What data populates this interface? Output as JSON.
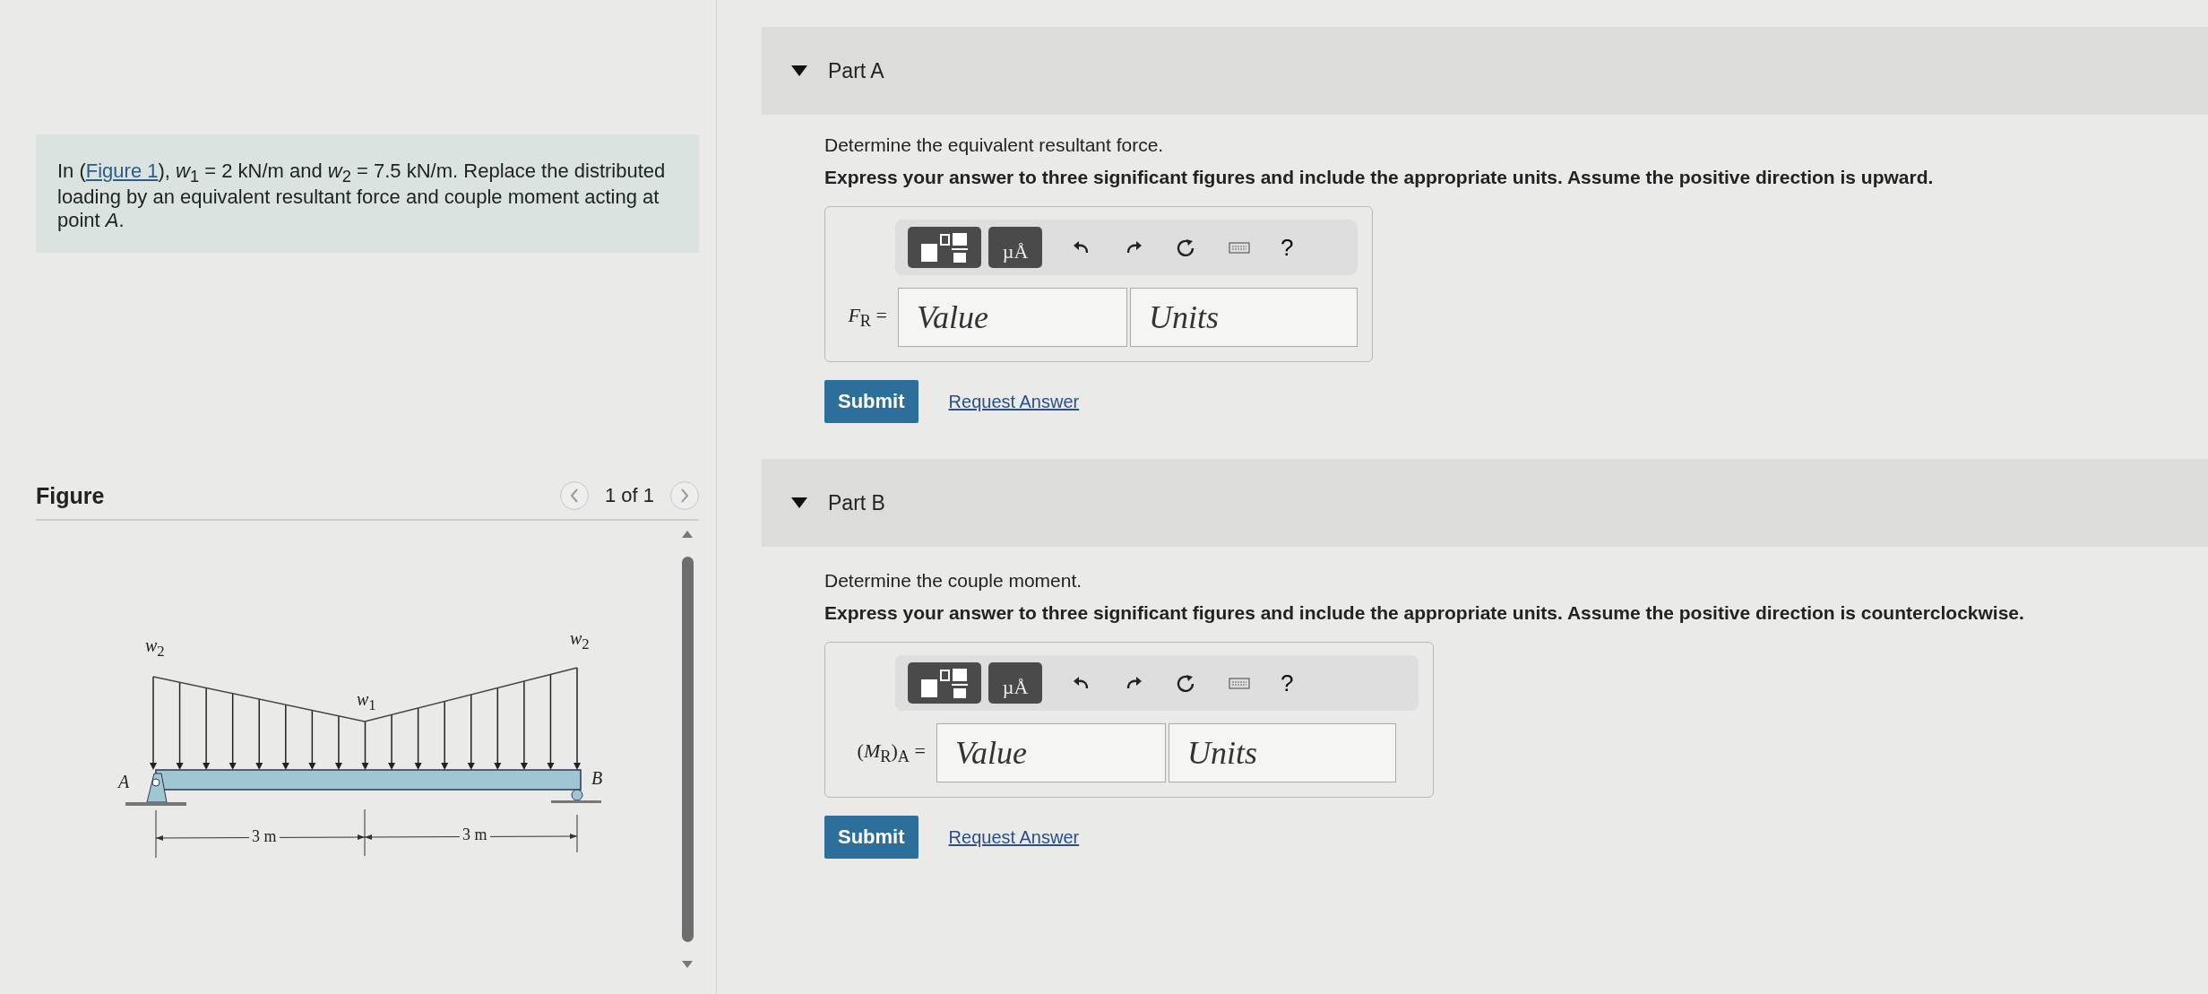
{
  "problem": {
    "text_before": "In (",
    "link": "Figure 1",
    "text_after": "), *w*$_{1}$ = 2 kN/m and *w*$_{2}$ = 7.5 kN/m. Replace the distributed loading by an equivalent resultant force and couple moment acting at point *A*."
  },
  "figure": {
    "title": "Figure",
    "pager": "1 of 1",
    "labels": [
      "*w*$_{2}$",
      "*w*$_{1}$",
      "*w*$_{2}$",
      "*A*",
      "*B*",
      "3 m",
      "3 m"
    ]
  },
  "parts": [
    {
      "title": "Part A",
      "expanded": true,
      "prompt": "Determine the equivalent resultant force.",
      "instruction": "Express your answer to three significant figures and include the appropriate units. Assume the positive direction is upward.",
      "units_button": "µÅ",
      "help": "?",
      "label": "*F*$_{R}$ =",
      "value_placeholder": "Value",
      "units_placeholder": "Units",
      "submit": "Submit",
      "request": "Request Answer"
    },
    {
      "title": "Part B",
      "expanded": true,
      "prompt": "Determine the couple moment.",
      "instruction": "Express your answer to three significant figures and include the appropriate units. Assume the positive direction is counterclockwise.",
      "units_button": "µÅ",
      "help": "?",
      "label": "(*M*$_{R}$)$_{A}$ =",
      "value_placeholder": "Value",
      "units_placeholder": "Units",
      "submit": "Submit",
      "request": "Request Answer"
    }
  ]
}
